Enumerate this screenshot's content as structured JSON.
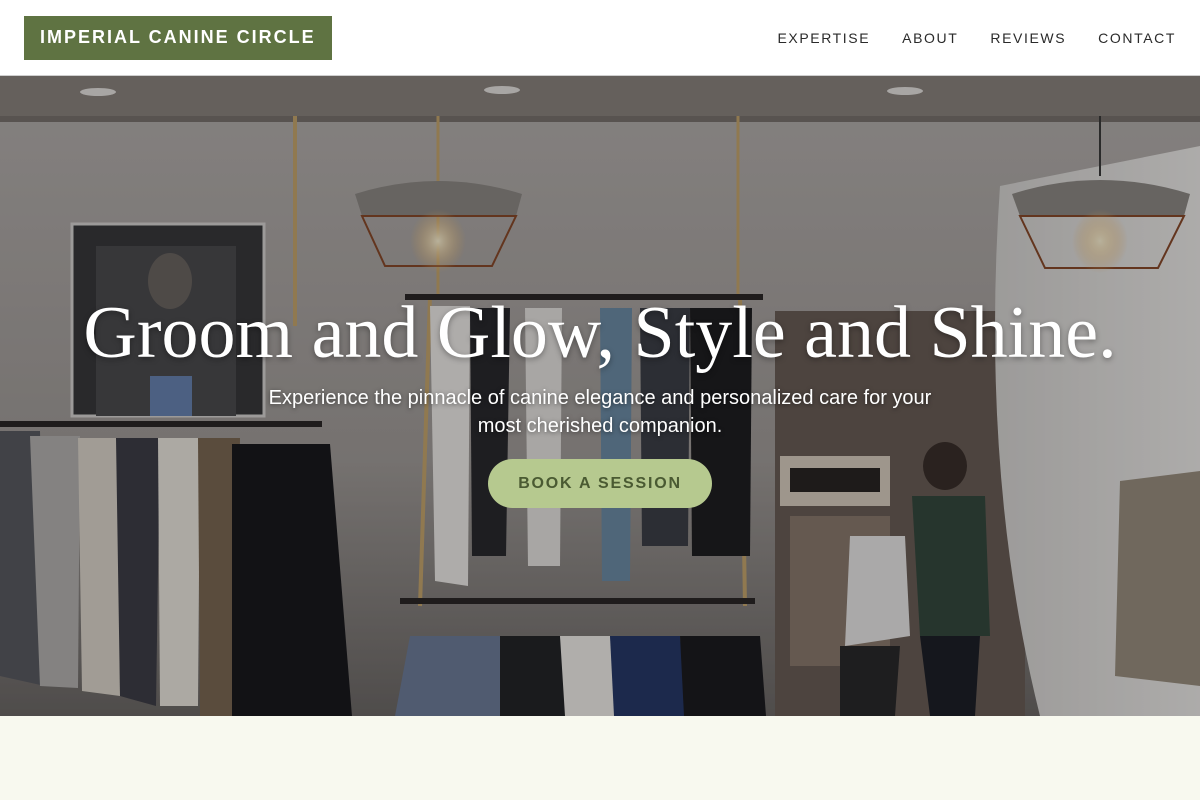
{
  "header": {
    "logo_text": "IMPERIAL CANINE CIRCLE",
    "nav": [
      {
        "label": "EXPERTISE"
      },
      {
        "label": "ABOUT"
      },
      {
        "label": "REVIEWS"
      },
      {
        "label": "CONTACT"
      }
    ]
  },
  "hero": {
    "title": "Groom and Glow, Style and Shine.",
    "subtitle": "Experience the pinnacle of canine elegance and personalized care for your most cherished companion.",
    "cta_label": "BOOK A SESSION",
    "background_image": "clothing-boutique-interior-photo"
  },
  "colors": {
    "brand": "#5f7342",
    "cta_bg": "#b6c98f",
    "cta_text": "#4a5a32",
    "page_bg": "#f8f9ef"
  }
}
